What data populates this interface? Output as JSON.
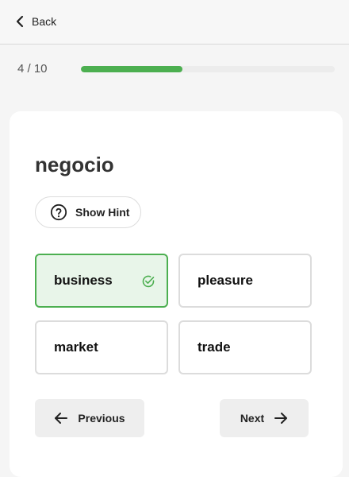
{
  "header": {
    "back_label": "Back",
    "back_icon": "chevron-left-icon"
  },
  "progress": {
    "label": "4 / 10",
    "current": 4,
    "total": 10,
    "fraction": 0.4,
    "color": "#4caf50"
  },
  "question": {
    "word": "negocio",
    "hint_label": "Show Hint",
    "hint_icon": "question-circle-icon"
  },
  "options": [
    {
      "label": "business",
      "correct": true
    },
    {
      "label": "pleasure",
      "correct": false
    },
    {
      "label": "market",
      "correct": false
    },
    {
      "label": "trade",
      "correct": false
    }
  ],
  "navigation": {
    "previous_label": "Previous",
    "next_label": "Next"
  },
  "colors": {
    "accent": "#4caf50",
    "correct_bg": "#e8f5e9"
  }
}
